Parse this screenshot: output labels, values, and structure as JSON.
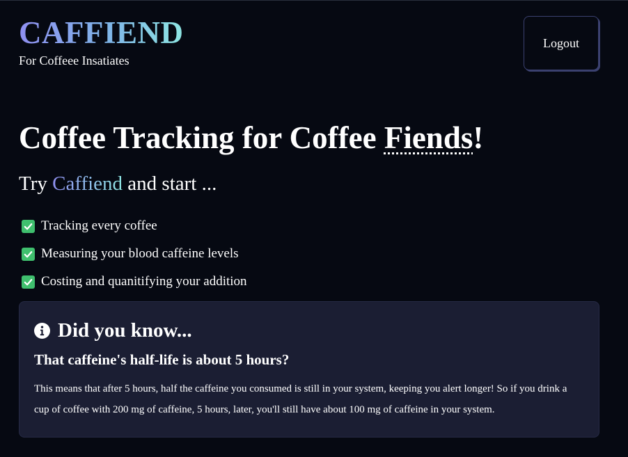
{
  "brand": {
    "title": "CAFFIEND",
    "tagline": "For Coffeee Insatiates"
  },
  "header": {
    "logout_label": "Logout"
  },
  "hero": {
    "heading_pre": "Coffee Tracking for Coffee ",
    "heading_emph": "Fiends",
    "heading_post": "!",
    "sub_pre": "Try ",
    "sub_brand": "Caffiend",
    "sub_post": " and start ..."
  },
  "features": [
    {
      "icon": "check-box-icon",
      "label": "Tracking every coffee"
    },
    {
      "icon": "check-box-icon",
      "label": "Measuring your blood caffeine levels"
    },
    {
      "icon": "check-box-icon",
      "label": "Costing and quanitifying your addition"
    }
  ],
  "info_card": {
    "icon": "info-icon",
    "title": "Did you know...",
    "subtitle": "That caffeine's half-life is about 5 hours?",
    "body": "This means that after 5 hours, half the caffeine you consumed is still in your system, keeping you alert longer! So if you drink a cup of coffee with 200 mg of caffeine, 5 hours, later, you'll still have about 100 mg of caffeine in your system."
  },
  "colors": {
    "background": "#060912",
    "card": "#1b1e33",
    "accent_start": "#8f8ff0",
    "accent_end": "#8ee6e3",
    "check": "#3fbf6e"
  }
}
